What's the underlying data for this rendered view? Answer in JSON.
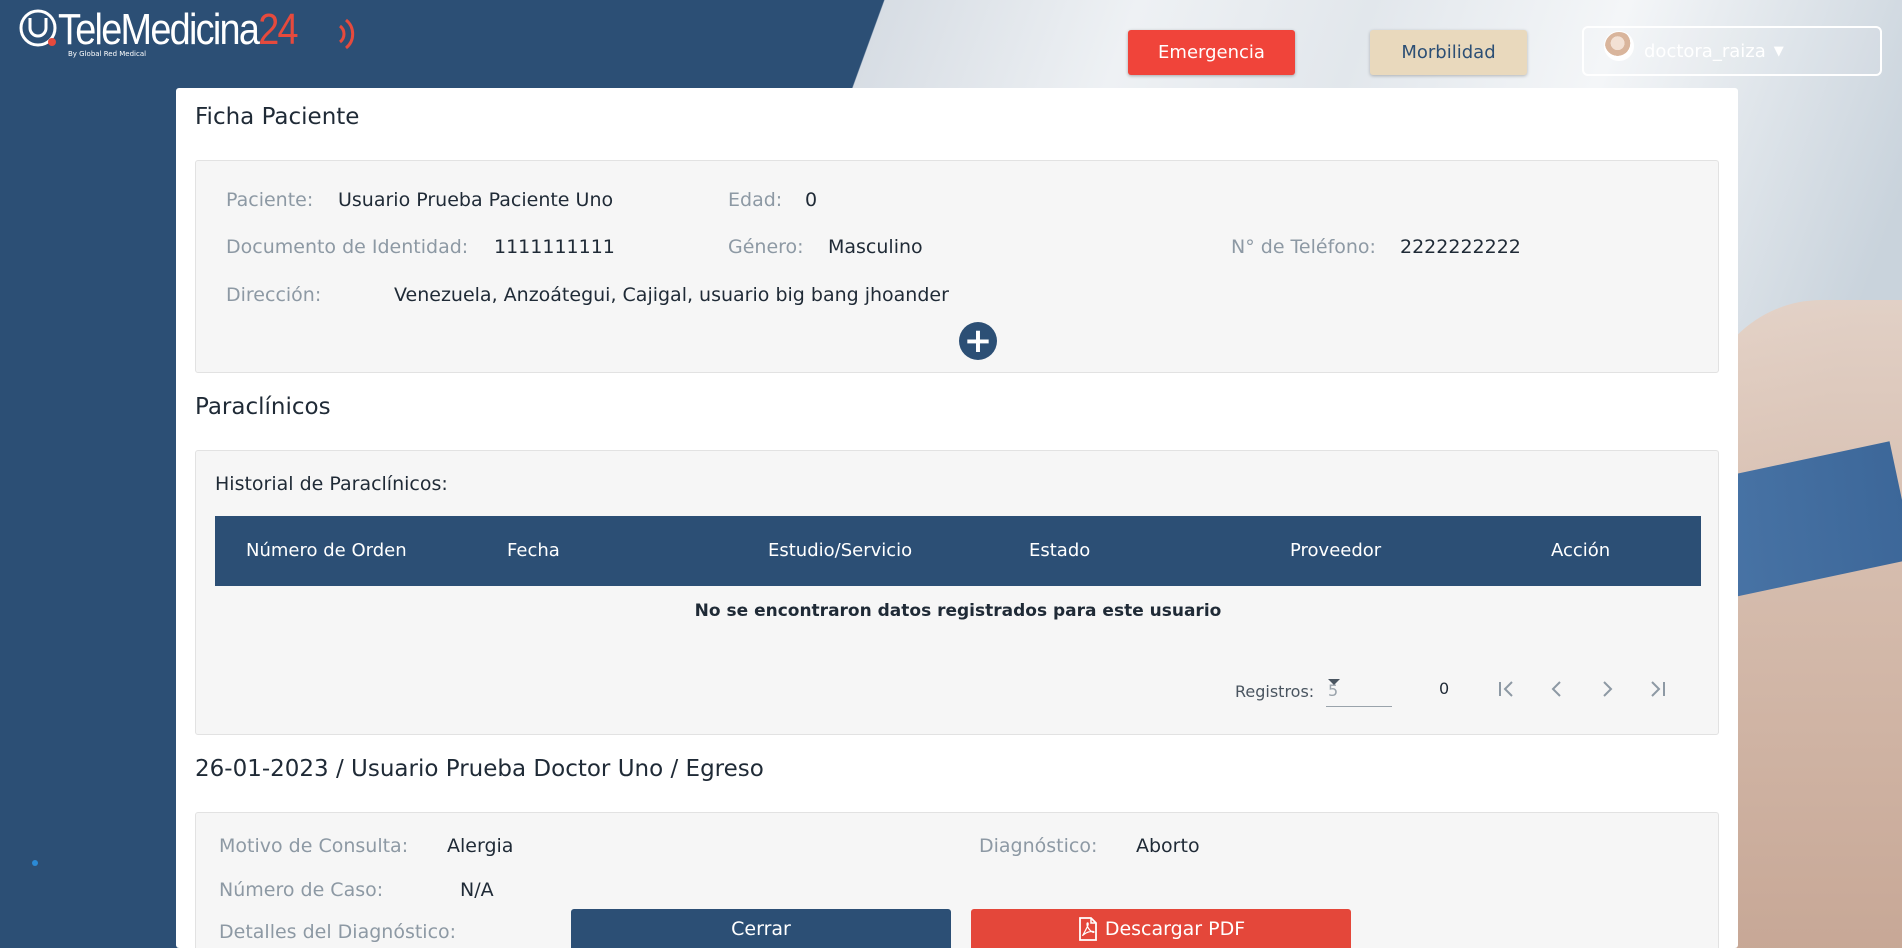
{
  "brand": {
    "name": "TeleMedicina",
    "number": "24",
    "tagline": "By Global Red Medical"
  },
  "header": {
    "emergency_label": "Emergencia",
    "morbidity_label": "Morbilidad",
    "user_name": "doctora_raiza"
  },
  "patient_card": {
    "title": "Ficha Paciente",
    "patient_label": "Paciente:",
    "patient_value": "Usuario Prueba Paciente Uno",
    "age_label": "Edad:",
    "age_value": "0",
    "id_label": "Documento de Identidad:",
    "id_value": "1111111111",
    "gender_label": "Género:",
    "gender_value": "Masculino",
    "phone_label": "N° de Teléfono:",
    "phone_value": "2222222222",
    "address_label": "Dirección:",
    "address_value": "Venezuela, Anzoátegui, Cajigal, usuario big bang jhoander"
  },
  "paraclinics": {
    "title": "Paraclínicos",
    "history_label": "Historial de Paraclínicos:",
    "columns": [
      "Número de Orden",
      "Fecha",
      "Estudio/Servicio",
      "Estado",
      "Proveedor",
      "Acción"
    ],
    "empty_message": "No se encontraron datos registrados para este usuario",
    "pager": {
      "records_label": "Registros:",
      "page_size": "5",
      "count": "0"
    }
  },
  "consultation": {
    "title": "26-01-2023 / Usuario Prueba Doctor Uno / Egreso",
    "reason_label": "Motivo de Consulta:",
    "reason_value": "Alergia",
    "diagnosis_label": "Diagnóstico:",
    "diagnosis_value": "Aborto",
    "case_label": "Número de Caso:",
    "case_value": "N/A",
    "details_label": "Detalles del Diagnóstico:",
    "close_label": "Cerrar",
    "pdf_label": "Descargar PDF"
  },
  "colors": {
    "primary": "#2c4f75",
    "danger": "#f0443a",
    "beige": "#e9d9bd",
    "panel": "#f6f6f6"
  }
}
